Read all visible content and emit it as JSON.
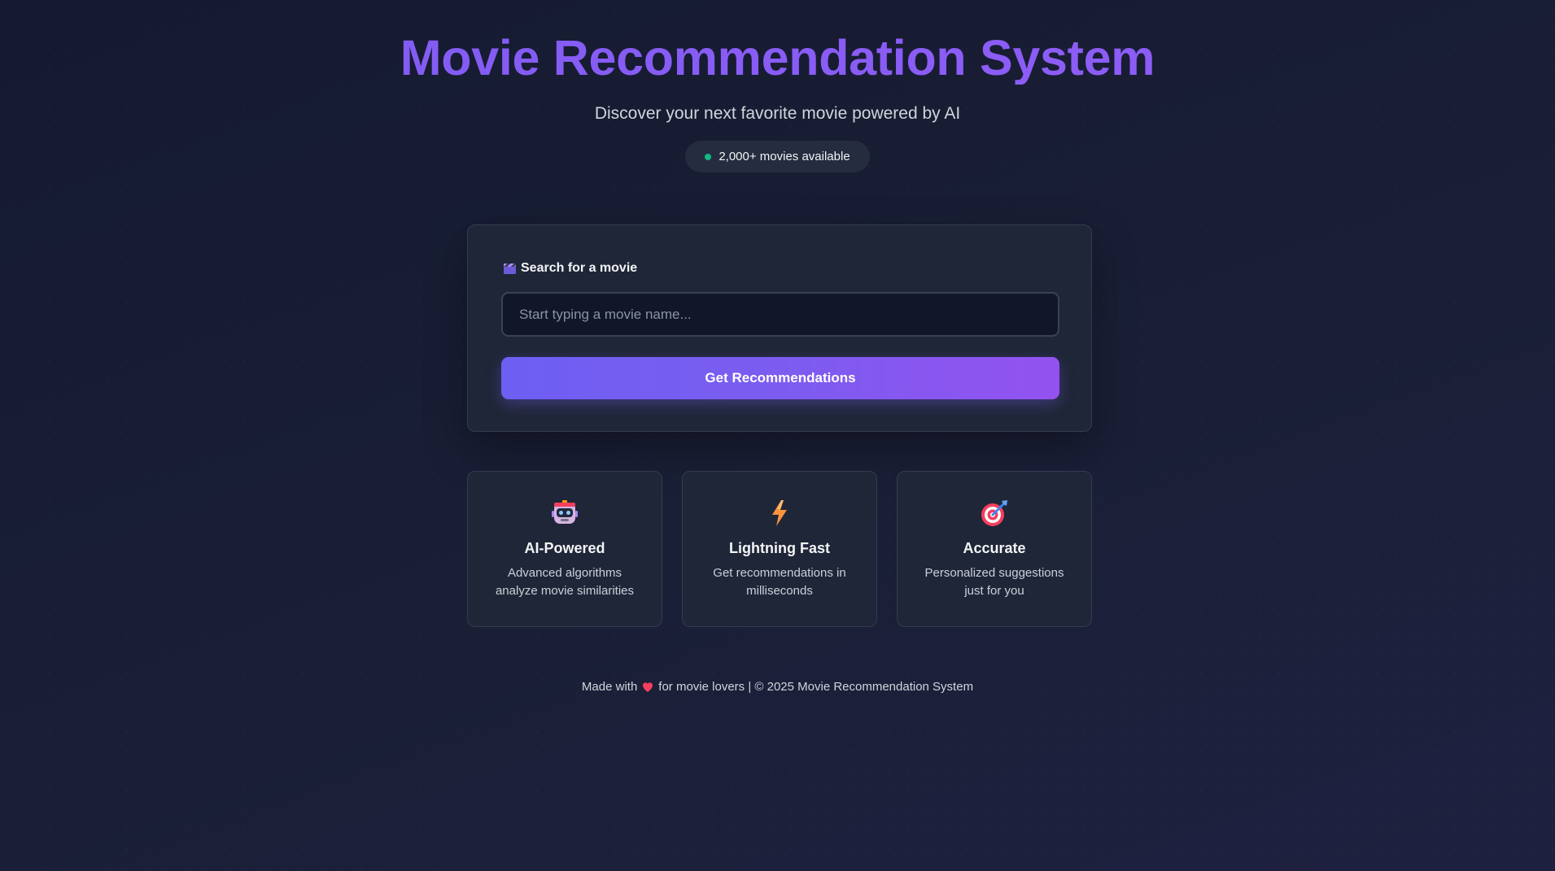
{
  "header": {
    "title": "Movie Recommendation System",
    "subtitle": "Discover your next favorite movie powered by AI",
    "badge": "2,000+ movies available",
    "badge_dot_color": "#10b981"
  },
  "search": {
    "label": "Search for a movie",
    "label_icon": "clapperboard-icon",
    "placeholder": "Start typing a movie name...",
    "value": "",
    "button_label": "Get Recommendations"
  },
  "features": [
    {
      "icon": "robot-icon",
      "title": "AI-Powered",
      "description": "Advanced algorithms analyze movie similarities"
    },
    {
      "icon": "lightning-icon",
      "title": "Lightning Fast",
      "description": "Get recommendations in milliseconds"
    },
    {
      "icon": "target-icon",
      "title": "Accurate",
      "description": "Personalized suggestions just for you"
    }
  ],
  "footer": {
    "prefix": "Made with",
    "icon": "heart-icon",
    "suffix": "for movie lovers | © 2025 Movie Recommendation System"
  },
  "colors": {
    "accent": "#8b5cf6",
    "button_start": "#6d5ff2",
    "button_end": "#9352f0",
    "background": "#1a1f36",
    "card": "#1f2637"
  }
}
